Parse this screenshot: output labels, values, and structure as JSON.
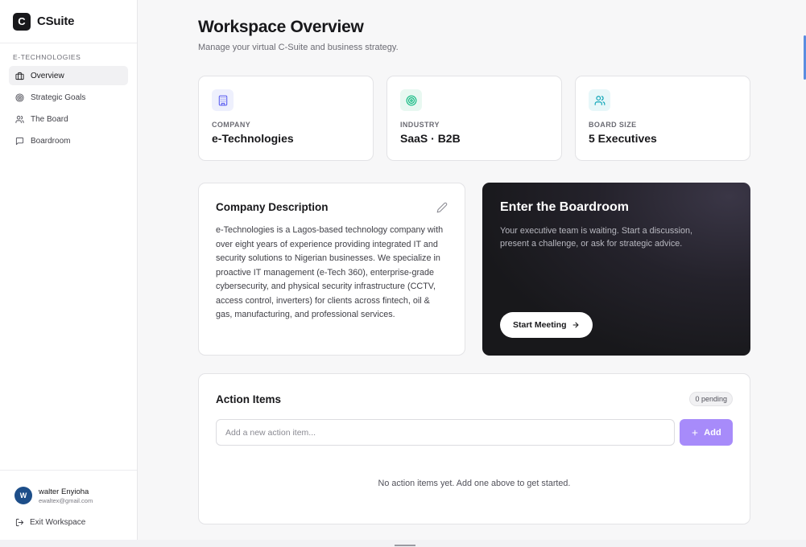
{
  "brand": {
    "logo_letter": "C",
    "name": "CSuite"
  },
  "sidebar": {
    "section_label": "E-TECHNOLOGIES",
    "items": [
      {
        "label": "Overview",
        "icon": "briefcase-icon",
        "active": true
      },
      {
        "label": "Strategic Goals",
        "icon": "target-icon"
      },
      {
        "label": "The Board",
        "icon": "users-icon"
      },
      {
        "label": "Boardroom",
        "icon": "message-square-icon"
      }
    ],
    "user": {
      "initial": "W",
      "name": "walter Enyioha",
      "email": "ewaltex@gmail.com"
    },
    "exit_label": "Exit Workspace"
  },
  "header": {
    "title": "Workspace Overview",
    "subtitle": "Manage your virtual C-Suite and business strategy."
  },
  "stats": [
    {
      "label": "COMPANY",
      "value": "e-Technologies",
      "icon": "building-icon",
      "color": "#6366f1",
      "bg": "#eef0fd"
    },
    {
      "label": "INDUSTRY",
      "value": "SaaS · B2B",
      "icon": "target-icon",
      "color": "#10b981",
      "bg": "#e8f8f1"
    },
    {
      "label": "BOARD SIZE",
      "value": "5 Executives",
      "icon": "users-icon",
      "color": "#0ea5b7",
      "bg": "#e7f7f9"
    }
  ],
  "description": {
    "title": "Company Description",
    "text": "e-Technologies is a Lagos-based technology company with over eight years of experience providing integrated IT and security solutions to Nigerian businesses. We specialize in proactive IT management (e-Tech 360), enterprise-grade cybersecurity, and physical security infrastructure (CCTV, access control, inverters) for clients across fintech, oil & gas, manufacturing, and professional services."
  },
  "boardroom": {
    "title": "Enter the Boardroom",
    "text": "Your executive team is waiting. Start a discussion, present a challenge, or ask for strategic advice.",
    "button_label": "Start Meeting"
  },
  "actions": {
    "title": "Action Items",
    "pending_label": "0 pending",
    "input_placeholder": "Add a new action item...",
    "input_value": "",
    "add_label": "Add",
    "empty_text": "No action items yet. Add one above to get started."
  },
  "colors": {
    "accent": "#a78bfa",
    "dark_card": "#18181b",
    "avatar": "#1d4e89"
  }
}
